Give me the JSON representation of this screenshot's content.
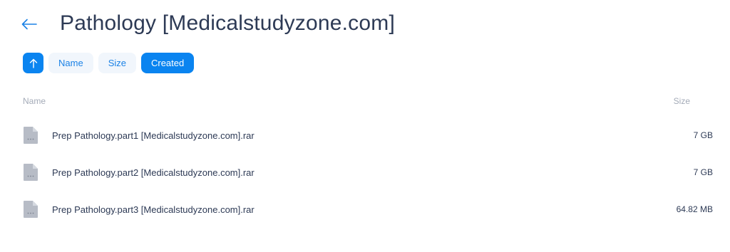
{
  "header": {
    "title": "Pathology [Medicalstudyzone.com]"
  },
  "sort": {
    "options": [
      {
        "label": "Name",
        "active": false
      },
      {
        "label": "Size",
        "active": false
      },
      {
        "label": "Created",
        "active": true
      }
    ],
    "direction": "ascending"
  },
  "columns": {
    "name": "Name",
    "size": "Size"
  },
  "files": [
    {
      "name": "Prep Pathology.part1 [Medicalstudyzone.com].rar",
      "size": "7 GB",
      "icon": "file-icon"
    },
    {
      "name": "Prep Pathology.part2 [Medicalstudyzone.com].rar",
      "size": "7 GB",
      "icon": "file-icon"
    },
    {
      "name": "Prep Pathology.part3 [Medicalstudyzone.com].rar",
      "size": "64.82 MB",
      "icon": "file-icon"
    }
  ],
  "colors": {
    "accent": "#0a84f0",
    "chip_bg": "#f1f6fc",
    "text": "#2d3a55",
    "muted": "#a4abb8"
  }
}
